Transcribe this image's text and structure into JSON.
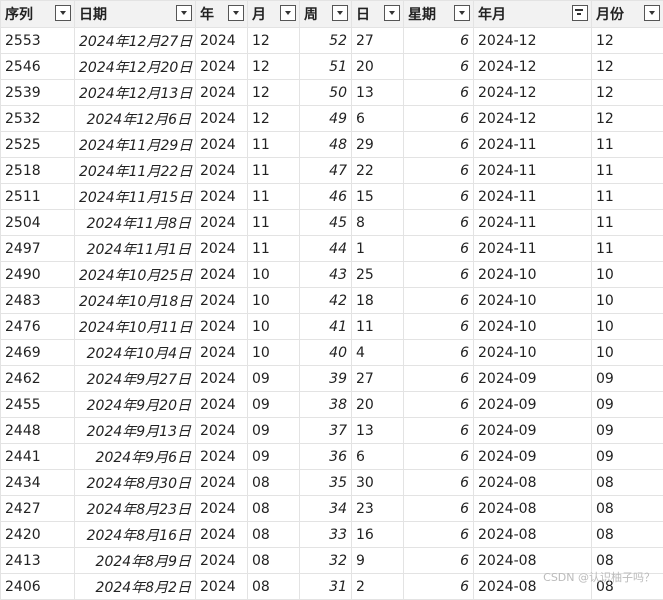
{
  "columns": [
    {
      "key": "seq",
      "label": "序列",
      "icon": "dropdown-icon"
    },
    {
      "key": "date",
      "label": "日期",
      "icon": "dropdown-icon"
    },
    {
      "key": "year",
      "label": "年",
      "icon": "dropdown-icon"
    },
    {
      "key": "month",
      "label": "月",
      "icon": "dropdown-icon"
    },
    {
      "key": "week",
      "label": "周",
      "icon": "dropdown-icon"
    },
    {
      "key": "day",
      "label": "日",
      "icon": "dropdown-icon"
    },
    {
      "key": "weekday",
      "label": "星期",
      "icon": "dropdown-icon"
    },
    {
      "key": "yearmonth",
      "label": "年月",
      "icon": "filter-active-icon"
    },
    {
      "key": "monthnum",
      "label": "月份",
      "icon": "dropdown-icon"
    }
  ],
  "rows": [
    [
      "2553",
      "2024年12月27日",
      "2024",
      "12",
      "52",
      "27",
      "6",
      "2024-12",
      "12"
    ],
    [
      "2546",
      "2024年12月20日",
      "2024",
      "12",
      "51",
      "20",
      "6",
      "2024-12",
      "12"
    ],
    [
      "2539",
      "2024年12月13日",
      "2024",
      "12",
      "50",
      "13",
      "6",
      "2024-12",
      "12"
    ],
    [
      "2532",
      "2024年12月6日",
      "2024",
      "12",
      "49",
      "6",
      "6",
      "2024-12",
      "12"
    ],
    [
      "2525",
      "2024年11月29日",
      "2024",
      "11",
      "48",
      "29",
      "6",
      "2024-11",
      "11"
    ],
    [
      "2518",
      "2024年11月22日",
      "2024",
      "11",
      "47",
      "22",
      "6",
      "2024-11",
      "11"
    ],
    [
      "2511",
      "2024年11月15日",
      "2024",
      "11",
      "46",
      "15",
      "6",
      "2024-11",
      "11"
    ],
    [
      "2504",
      "2024年11月8日",
      "2024",
      "11",
      "45",
      "8",
      "6",
      "2024-11",
      "11"
    ],
    [
      "2497",
      "2024年11月1日",
      "2024",
      "11",
      "44",
      "1",
      "6",
      "2024-11",
      "11"
    ],
    [
      "2490",
      "2024年10月25日",
      "2024",
      "10",
      "43",
      "25",
      "6",
      "2024-10",
      "10"
    ],
    [
      "2483",
      "2024年10月18日",
      "2024",
      "10",
      "42",
      "18",
      "6",
      "2024-10",
      "10"
    ],
    [
      "2476",
      "2024年10月11日",
      "2024",
      "10",
      "41",
      "11",
      "6",
      "2024-10",
      "10"
    ],
    [
      "2469",
      "2024年10月4日",
      "2024",
      "10",
      "40",
      "4",
      "6",
      "2024-10",
      "10"
    ],
    [
      "2462",
      "2024年9月27日",
      "2024",
      "09",
      "39",
      "27",
      "6",
      "2024-09",
      "09"
    ],
    [
      "2455",
      "2024年9月20日",
      "2024",
      "09",
      "38",
      "20",
      "6",
      "2024-09",
      "09"
    ],
    [
      "2448",
      "2024年9月13日",
      "2024",
      "09",
      "37",
      "13",
      "6",
      "2024-09",
      "09"
    ],
    [
      "2441",
      "2024年9月6日",
      "2024",
      "09",
      "36",
      "6",
      "6",
      "2024-09",
      "09"
    ],
    [
      "2434",
      "2024年8月30日",
      "2024",
      "08",
      "35",
      "30",
      "6",
      "2024-08",
      "08"
    ],
    [
      "2427",
      "2024年8月23日",
      "2024",
      "08",
      "34",
      "23",
      "6",
      "2024-08",
      "08"
    ],
    [
      "2420",
      "2024年8月16日",
      "2024",
      "08",
      "33",
      "16",
      "6",
      "2024-08",
      "08"
    ],
    [
      "2413",
      "2024年8月9日",
      "2024",
      "08",
      "32",
      "9",
      "6",
      "2024-08",
      "08"
    ],
    [
      "2406",
      "2024年8月2日",
      "2024",
      "08",
      "31",
      "2",
      "6",
      "2024-08",
      "08"
    ]
  ],
  "watermark": "CSDN @认识柚子吗？"
}
